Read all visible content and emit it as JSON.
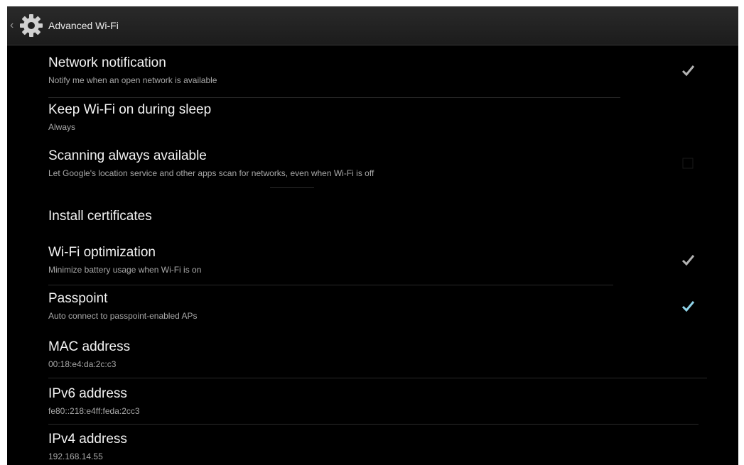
{
  "action_bar": {
    "title": "Advanced Wi-Fi",
    "up_icon": "chevron-left-icon",
    "app_icon": "gear-icon"
  },
  "preferences": [
    {
      "title": "Network notification",
      "summary": "Notify me when an open network is available",
      "checkbox": true,
      "checked": true
    },
    {
      "title": "Keep Wi-Fi on during sleep",
      "summary": "Always"
    },
    {
      "title": "Scanning always available",
      "summary": "Let Google's location service and other apps scan for networks, even when Wi-Fi is off",
      "checkbox": true,
      "checked": false
    },
    {
      "title": "Install certificates"
    },
    {
      "title": "Wi-Fi optimization",
      "summary": "Minimize battery usage when Wi-Fi is on",
      "checkbox": true,
      "checked": true
    },
    {
      "title": "Passpoint",
      "summary": "Auto connect to passpoint-enabled APs",
      "checkbox": true,
      "checked": true
    },
    {
      "title": "MAC address",
      "summary": "00:18:e4:da:2c:c3"
    },
    {
      "title": "IPv6 address",
      "summary": "fe80::218:e4ff:feda:2cc3"
    },
    {
      "title": "IPv4 address",
      "summary": "192.168.14.55"
    }
  ],
  "colors": {
    "background": "#000000",
    "check_accent": "#b3b3b3",
    "passpoint_check": "#33b5e5"
  }
}
